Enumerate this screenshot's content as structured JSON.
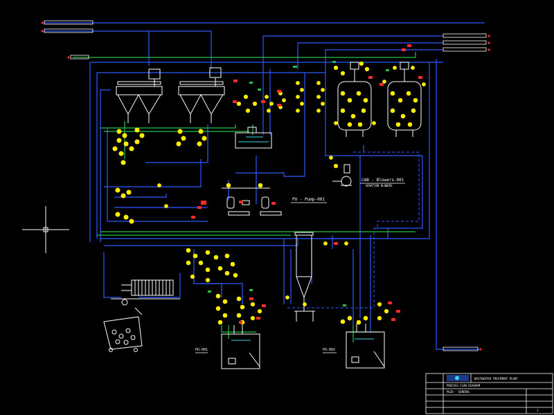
{
  "colors": {
    "background": "#000000",
    "process_line_blue": "#2f5bff",
    "process_line_green": "#27c24a",
    "equipment_white": "#ffffff",
    "instrument_yellow": "#ffee00",
    "alarm_red": "#ff2a2a",
    "cyan_accent": "#3fd8e6"
  },
  "labels": {
    "blowers": "CAB - Blowers-001",
    "blowers_sub": "AERATION BLOWERS",
    "pump": "PU - Pump-001",
    "pu_tank_left": "PU-001",
    "pu_tank_right": "PU-002",
    "sheet_number": "1"
  },
  "title_block": {
    "line1": "WASTEWATER TREATMENT PLANT",
    "line2": "PROCESS FLOW DIAGRAM",
    "line3": "P&ID - GENERAL"
  }
}
